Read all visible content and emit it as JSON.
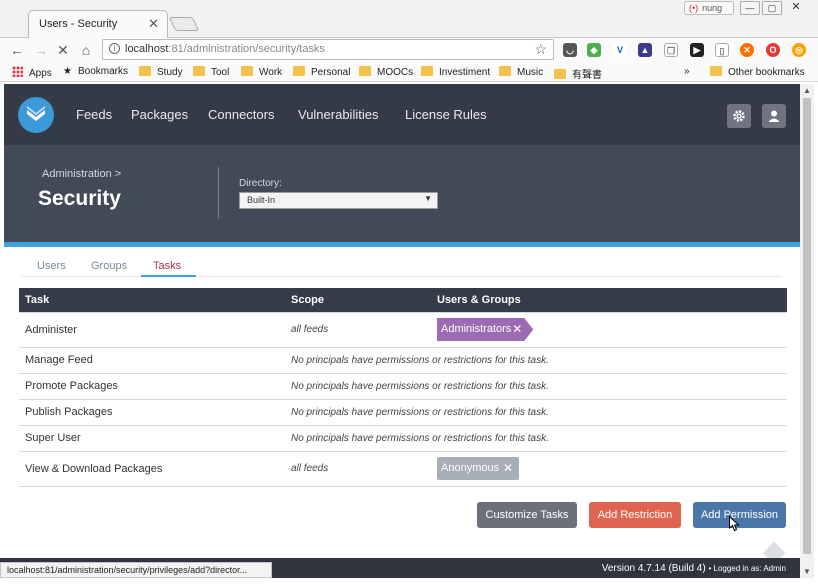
{
  "browser": {
    "tab_title": "Users - Security",
    "tab_close": "✕",
    "profile_name": "nung",
    "url_host": "localhost",
    "url_path": ":81/administration/security/tasks",
    "bookmarks": [
      "Apps",
      "Bookmarks",
      "Study",
      "Tool",
      "Work",
      "Personal",
      "MOOCs",
      "Investiment",
      "Music",
      "有聲書"
    ],
    "bookmarks_overflow": "»",
    "other_bookmarks": "Other bookmarks",
    "status_url": "localhost:81/administration/security/privileges/add?director..."
  },
  "nav": {
    "links": [
      "Feeds",
      "Packages",
      "Connectors",
      "Vulnerabilities",
      "License Rules"
    ]
  },
  "header": {
    "breadcrumb": "Administration >",
    "title": "Security",
    "directory_label": "Directory:",
    "directory_value": "Built-In"
  },
  "tabs": {
    "users": "Users",
    "groups": "Groups",
    "tasks": "Tasks",
    "active": "Tasks"
  },
  "table": {
    "headers": [
      "Task",
      "Scope",
      "Users & Groups"
    ],
    "rows": [
      {
        "task": "Administer",
        "scope": "all feeds",
        "principal": "Administrators"
      },
      {
        "task": "Manage Feed",
        "scope": "No principals have permissions or restrictions for this task."
      },
      {
        "task": "Promote Packages",
        "scope": "No principals have permissions or restrictions for this task."
      },
      {
        "task": "Publish Packages",
        "scope": "No principals have permissions or restrictions for this task."
      },
      {
        "task": "Super User",
        "scope": "No principals have permissions or restrictions for this task."
      },
      {
        "task": "View & Download Packages",
        "scope": "all feeds",
        "principal": "Anonymous"
      }
    ],
    "remove_glyph": "✕"
  },
  "actions": {
    "customize": "Customize Tasks",
    "restriction": "Add Restriction",
    "permission": "Add Permission"
  },
  "footer": {
    "version": "Version 4.7.14 (Build 4)",
    "logged_in": "• Logged in as: Admin"
  },
  "colors": {
    "nav_bg": "#343a46",
    "accent_blue": "#3da3e2",
    "admin_pill": "#9d6bb3",
    "danger": "#e06452"
  },
  "icons": [
    "info-icon",
    "star-icon",
    "settings-gear-icon",
    "user-icon",
    "proget-logo-icon"
  ]
}
